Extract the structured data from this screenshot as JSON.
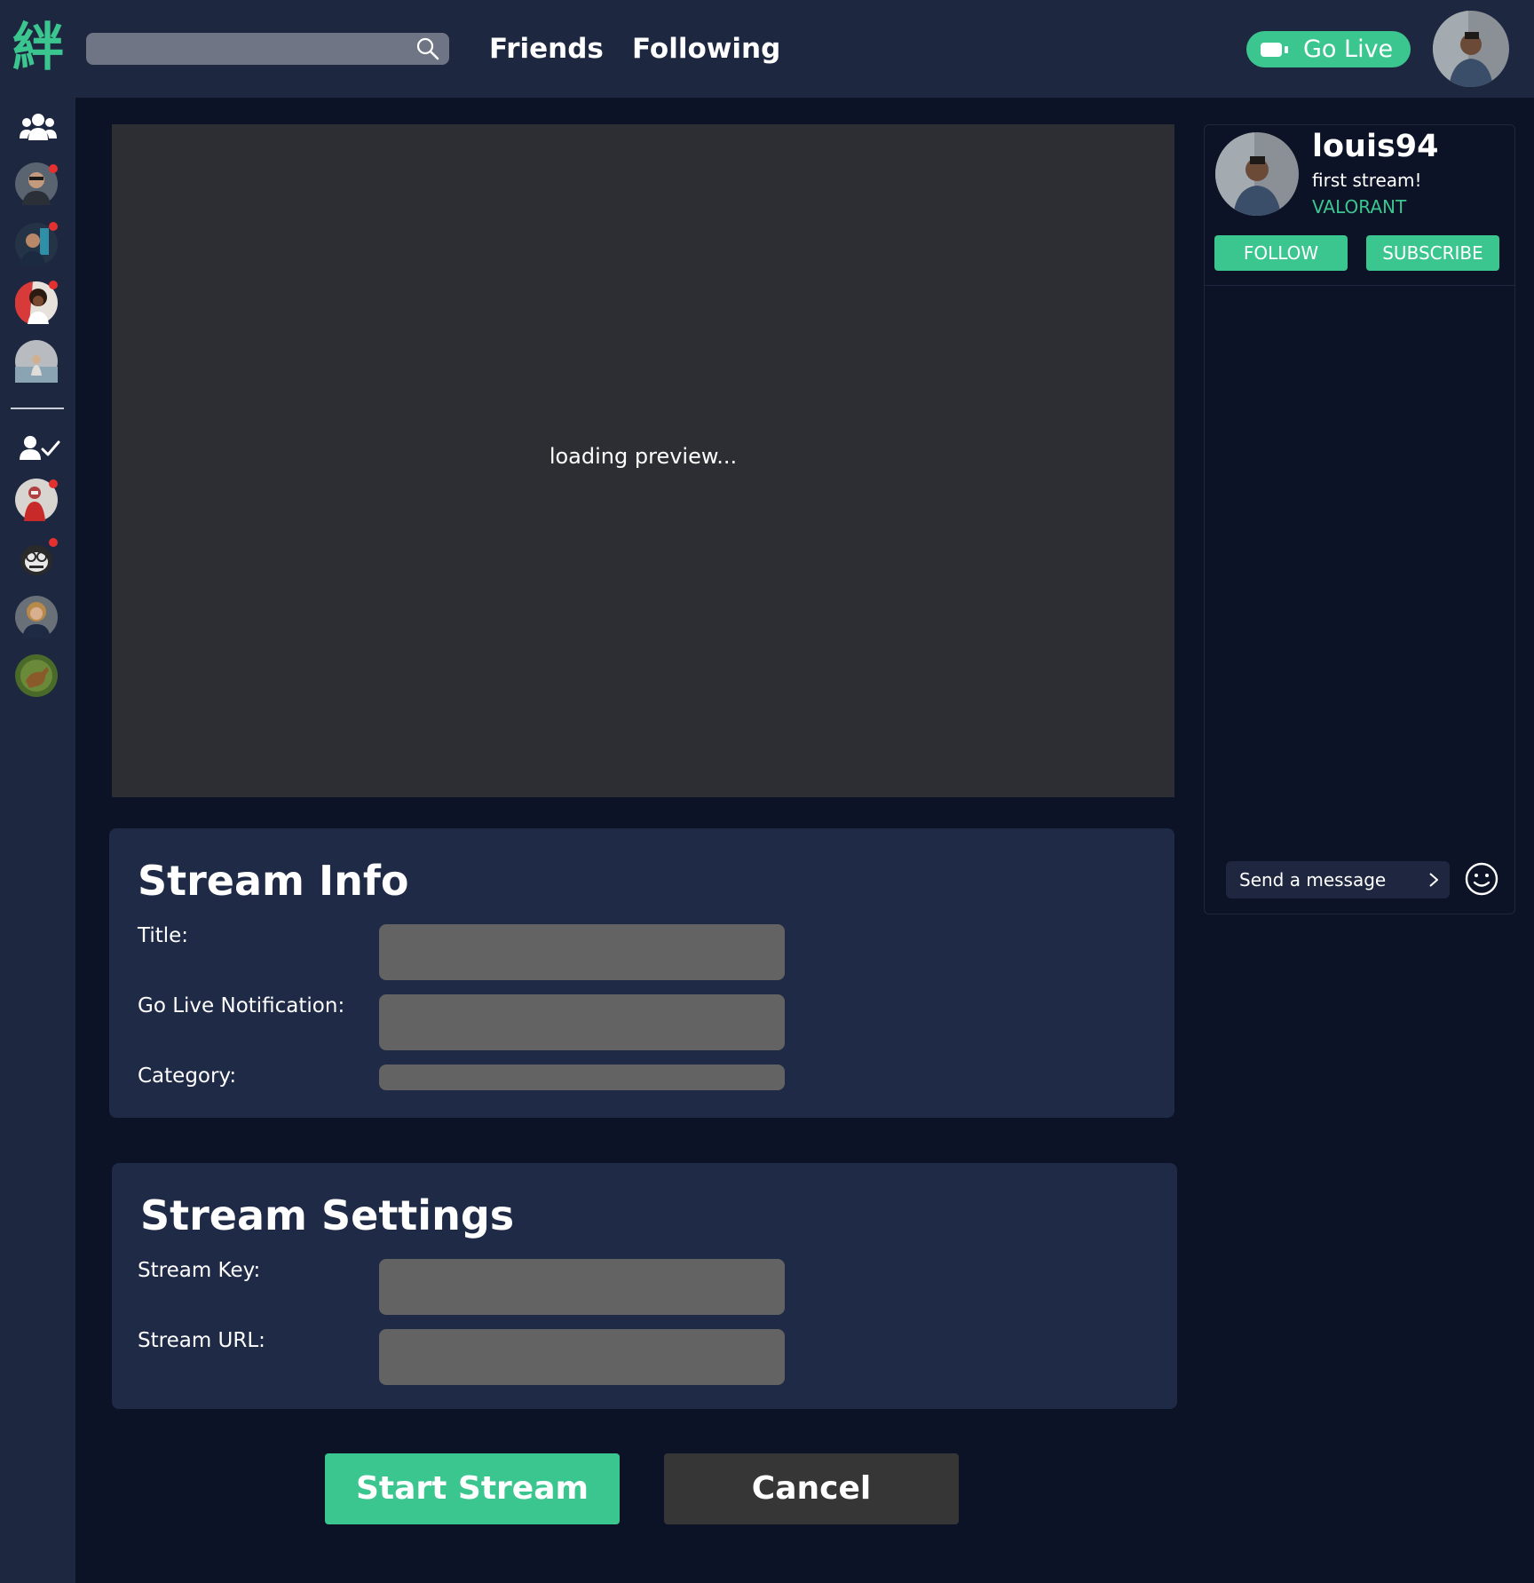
{
  "app": {
    "logo_glyph": "絆"
  },
  "header": {
    "search_placeholder": "",
    "nav": [
      "Friends",
      "Following"
    ],
    "go_live_label": "Go Live"
  },
  "colors": {
    "accent": "#3cc68f",
    "topbar": "#1e2740",
    "page_bg": "#0d1326",
    "panel": "#1f2a47",
    "input": "#636363",
    "notification_dot": "#e53030"
  },
  "sidebar": {
    "friends_icon": "users-icon",
    "following_icon": "user-check-icon"
  },
  "preview": {
    "status_text": "loading preview..."
  },
  "stream_info": {
    "title": "Stream Info",
    "fields": {
      "title_label": "Title:",
      "notification_label": "Go Live Notification:",
      "category_label": "Category:"
    }
  },
  "stream_settings": {
    "title": "Stream Settings",
    "fields": {
      "key_label": "Stream Key:",
      "url_label": "Stream URL:"
    }
  },
  "actions": {
    "start_label": "Start Stream",
    "cancel_label": "Cancel"
  },
  "chat": {
    "username": "louis94",
    "stream_title": "first stream!",
    "game": "VALORANT",
    "follow_label": "FOLLOW",
    "subscribe_label": "SUBSCRIBE",
    "message_placeholder": "Send a message"
  }
}
